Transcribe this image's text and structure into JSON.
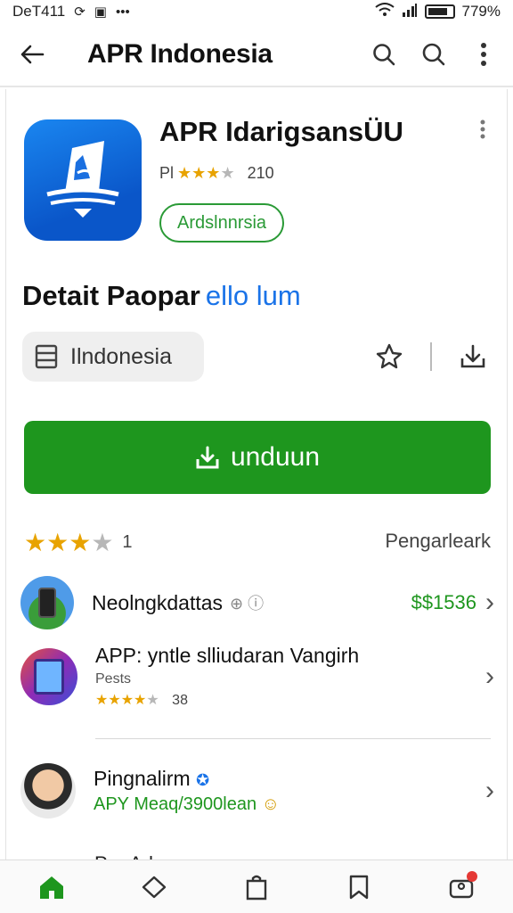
{
  "status_bar": {
    "left_text": "DeT411",
    "right_text": "779%"
  },
  "app_bar": {
    "title": "APR Indonesia"
  },
  "app": {
    "name": "APR IdarigsansÜU",
    "rating_prefix": "Pl",
    "rating_stars": 3.5,
    "rating_count": "210",
    "chip_label": "Ardslnnrsia"
  },
  "section": {
    "title": "Detait Paopar",
    "accent": "ello lum"
  },
  "language_chip": {
    "label": "Ilndonesia"
  },
  "install_button": {
    "label": "unduun"
  },
  "rating_summary": {
    "stars": 3,
    "value": "1",
    "link": "Pengarleark"
  },
  "list": [
    {
      "title": "Neolngkdattas",
      "price": "$$1536"
    },
    {
      "title": "APP: yntle slliudaran Vangirh",
      "subtitle": "Pests",
      "stars": 4,
      "rating": "38"
    },
    {
      "title": "Pingnalirm",
      "subtitle": "APY Meaq/3900lean"
    }
  ],
  "peek_item": {
    "title": "Pr...Ad..."
  },
  "colors": {
    "accent_green": "#1e961e",
    "accent_blue": "#1a73e8",
    "star": "#e8a300"
  },
  "icons": [
    "back-arrow-icon",
    "search-icon",
    "kebab-menu-icon",
    "document-icon",
    "star-add-icon",
    "download-icon",
    "home-icon",
    "tag-icon",
    "bag-icon",
    "bookmark-icon",
    "account-icon"
  ]
}
